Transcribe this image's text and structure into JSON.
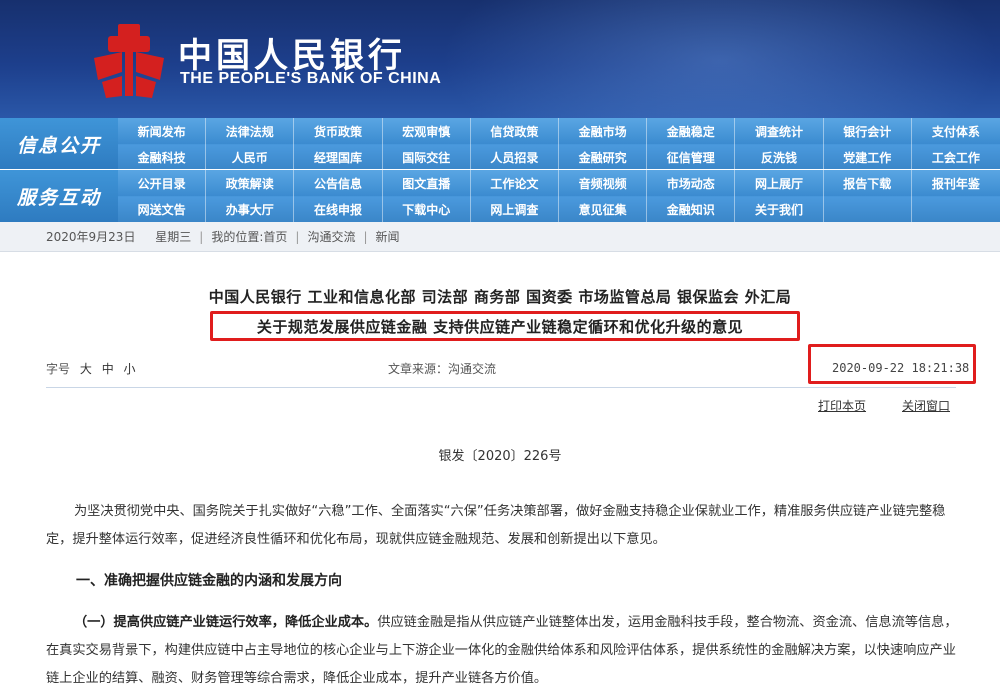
{
  "header": {
    "bank_name_cn": "中国人民银行",
    "bank_name_en": "THE PEOPLE'S BANK OF CHINA",
    "logo_icon": "pboc-logo-icon",
    "colors": {
      "banner": "#1d3f8c",
      "nav": "#3a86c8",
      "highlight": "#e01d1d",
      "logo": "#d4201f"
    }
  },
  "nav": {
    "info_label": "信息公开",
    "info_items": [
      "新闻发布",
      "法律法规",
      "货币政策",
      "宏观审慎",
      "信贷政策",
      "金融市场",
      "金融稳定",
      "调查统计",
      "银行会计",
      "支付体系",
      "金融科技",
      "人民币",
      "经理国库",
      "国际交往",
      "人员招录",
      "金融研究",
      "征信管理",
      "反洗钱",
      "党建工作",
      "工会工作"
    ],
    "service_label": "服务互动",
    "service_items": [
      "公开目录",
      "政策解读",
      "公告信息",
      "图文直播",
      "工作论文",
      "音频视频",
      "市场动态",
      "网上展厅",
      "报告下载",
      "报刊年鉴",
      "网送文告",
      "办事大厅",
      "在线申报",
      "下载中心",
      "网上调查",
      "意见征集",
      "金融知识",
      "关于我们",
      "",
      ""
    ]
  },
  "breadcrumb": {
    "date": "2020年9月23日",
    "weekday": "星期三",
    "location_label": "我的位置:",
    "home": "首页",
    "section": "沟通交流",
    "page": "新闻"
  },
  "article": {
    "agencies": "中国人民银行  工业和信息化部  司法部  商务部  国资委  市场监管总局  银保监会  外汇局",
    "title": "关于规范发展供应链金融  支持供应链产业链稳定循环和优化升级的意见",
    "font_size_label": "字号",
    "font_sizes": [
      "大",
      "中",
      "小"
    ],
    "source": "文章来源：沟通交流",
    "datetime": "2020-09-22  18:21:38",
    "print_label": "打印本页",
    "close_label": "关闭窗口",
    "doc_number": "银发〔2020〕226号",
    "para1": "为坚决贯彻党中央、国务院关于扎实做好“六稳”工作、全面落实“六保”任务决策部署，做好金融支持稳企业保就业工作，精准服务供应链产业链完整稳定，提升整体运行效率，促进经济良性循环和优化布局，现就供应链金融规范、发展和创新提出以下意见。",
    "heading1": "一、准确把握供应链金融的内涵和发展方向",
    "para2_lead": "（一）提高供应链产业链运行效率，降低企业成本。",
    "para2_body": "供应链金融是指从供应链产业链整体出发，运用金融科技手段，整合物流、资金流、信息流等信息，在真实交易背景下，构建供应链中占主导地位的核心企业与上下游企业一体化的金融供给体系和风险评估体系，提供系统性的金融解决方案，以快速响应产业链上企业的结算、融资、财务管理等综合需求，降低企业成本，提升产业链各方价值。"
  }
}
